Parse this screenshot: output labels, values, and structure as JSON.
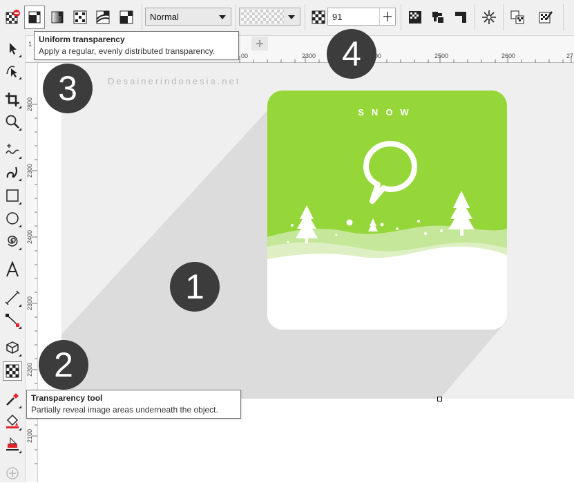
{
  "propertyBar": {
    "blendMode": "Normal",
    "transparencyValue": "91"
  },
  "tooltips": {
    "uniform": {
      "title": "Uniform transparency",
      "description": "Apply a regular, evenly distributed transparency."
    },
    "tool": {
      "title": "Transparency tool",
      "description": "Partially reveal image areas underneath the object."
    }
  },
  "rulers": {
    "horizontal": [
      "1",
      "2300",
      "2500",
      "2600",
      "27"
    ],
    "horizontalPartial": [
      "00",
      "00"
    ],
    "vertical": [
      "2800",
      "2300",
      "2400",
      "2300",
      "2200",
      "2100"
    ]
  },
  "watermark": "Desainerindonesia.net",
  "card": {
    "title": "SNOW",
    "greenColor": "#95d639"
  },
  "callouts": [
    "1",
    "2",
    "3",
    "4"
  ],
  "icons": {
    "toolbox": [
      "pick-tool-icon",
      "shape-tool-icon",
      "crop-tool-icon",
      "zoom-tool-icon",
      "freehand-tool-icon",
      "artistic-media-icon",
      "rectangle-tool-icon",
      "ellipse-tool-icon",
      "spiral-tool-icon",
      "text-tool-icon",
      "dimension-tool-icon",
      "connector-tool-icon",
      "extrude-tool-icon",
      "transparency-tool-icon",
      "eyedropper-tool-icon",
      "fill-tool-icon",
      "smart-fill-icon",
      "add-tool-icon"
    ]
  }
}
